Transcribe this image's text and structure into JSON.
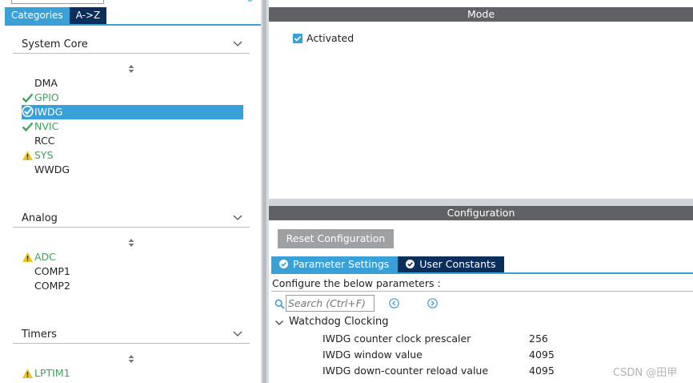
{
  "left": {
    "tabs": [
      {
        "label": "Categories",
        "active": true
      },
      {
        "label": "A->Z",
        "active": false
      }
    ],
    "categories": [
      {
        "title": "System Core",
        "items": [
          {
            "label": "DMA",
            "status": "none"
          },
          {
            "label": "GPIO",
            "status": "ok"
          },
          {
            "label": "IWDG",
            "status": "selected"
          },
          {
            "label": "NVIC",
            "status": "ok"
          },
          {
            "label": "RCC",
            "status": "none"
          },
          {
            "label": "SYS",
            "status": "warn"
          },
          {
            "label": "WWDG",
            "status": "none"
          }
        ]
      },
      {
        "title": "Analog",
        "items": [
          {
            "label": "ADC",
            "status": "warn"
          },
          {
            "label": "COMP1",
            "status": "none"
          },
          {
            "label": "COMP2",
            "status": "none"
          }
        ]
      },
      {
        "title": "Timers",
        "items": [
          {
            "label": "LPTIM1",
            "status": "warn"
          }
        ]
      }
    ]
  },
  "mode": {
    "title": "Mode",
    "activated_label": "Activated",
    "activated_checked": true
  },
  "config": {
    "title": "Configuration",
    "reset_label": "Reset Configuration",
    "tabs": [
      {
        "label": "Parameter Settings",
        "active": true
      },
      {
        "label": "User Constants",
        "active": false
      }
    ],
    "description": "Configure the below parameters :",
    "search_placeholder": "Search (Ctrl+F)",
    "group": {
      "title": "Watchdog Clocking",
      "params": [
        {
          "name": "IWDG counter clock prescaler",
          "value": "256"
        },
        {
          "name": "IWDG window value",
          "value": "4095"
        },
        {
          "name": "IWDG down-counter reload value",
          "value": "4095"
        }
      ]
    }
  },
  "watermark": "CSDN @田甲",
  "colors": {
    "accent": "#39a0d8",
    "dark_tab": "#0b2f5a",
    "section_bar": "#5f6164",
    "ok_green": "#3ca35a",
    "warn_yellow": "#f3c613"
  },
  "icons": {
    "category_collapse": "chevron-down-icon",
    "sort": "sort-arrows-icon",
    "ok": "checkmark-icon",
    "warn": "warning-triangle-icon",
    "selected": "check-circle-icon",
    "search": "search-icon",
    "prev": "prev-circle-icon",
    "next": "next-circle-icon"
  }
}
